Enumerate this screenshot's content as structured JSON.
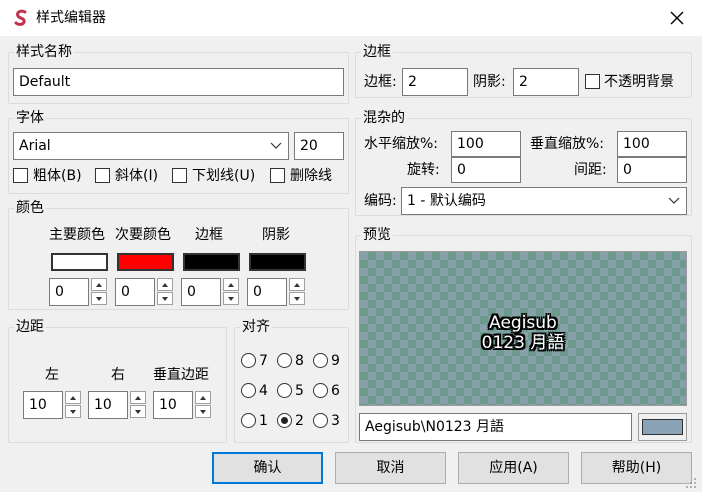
{
  "window": {
    "title": "样式编辑器"
  },
  "style_name": {
    "label": "样式名称",
    "value": "Default"
  },
  "font": {
    "label": "字体",
    "family": "Arial",
    "size": "20",
    "bold": "粗体(B)",
    "italic": "斜体(I)",
    "underline": "下划线(U)",
    "strikeout": "删除线"
  },
  "colors": {
    "label": "颜色",
    "primary": "主要颜色",
    "secondary": "次要颜色",
    "outline": "边框",
    "shadow": "阴影",
    "primary_hex": "#ffffff",
    "secondary_hex": "#ff0000",
    "outline_hex": "#000000",
    "shadow_hex": "#000000",
    "alpha_primary": "0",
    "alpha_secondary": "0",
    "alpha_outline": "0",
    "alpha_shadow": "0"
  },
  "margins": {
    "label": "边距",
    "left": "左",
    "right": "右",
    "vertical": "垂直边距",
    "left_value": "10",
    "right_value": "10",
    "vertical_value": "10"
  },
  "alignment": {
    "label": "对齐",
    "options": [
      "7",
      "8",
      "9",
      "4",
      "5",
      "6",
      "1",
      "2",
      "3"
    ],
    "selected": "2"
  },
  "border": {
    "label": "边框",
    "outline_label": "边框:",
    "outline_value": "2",
    "shadow_label": "阴影:",
    "shadow_value": "2",
    "opaque_box": "不透明背景"
  },
  "misc": {
    "label": "混杂的",
    "scale_x_label": "水平缩放%:",
    "scale_x": "100",
    "scale_y_label": "垂直缩放%:",
    "scale_y": "100",
    "rotation_label": "旋转:",
    "rotation": "0",
    "spacing_label": "间距:",
    "spacing": "0",
    "encoding_label": "编码:",
    "encoding": "1 - 默认编码"
  },
  "preview": {
    "label": "预览",
    "line1": "Aegisub",
    "line2": "0123 月語",
    "input": "Aegisub\\N0123 月語",
    "bg_color": "#8aa2b5"
  },
  "buttons": {
    "ok": "确认",
    "cancel": "取消",
    "apply": "应用(A)",
    "help": "帮助(H)"
  },
  "icons": {
    "app": "aegisub-logo-icon",
    "close": "close-icon",
    "dropdown": "chevron-down-icon"
  }
}
